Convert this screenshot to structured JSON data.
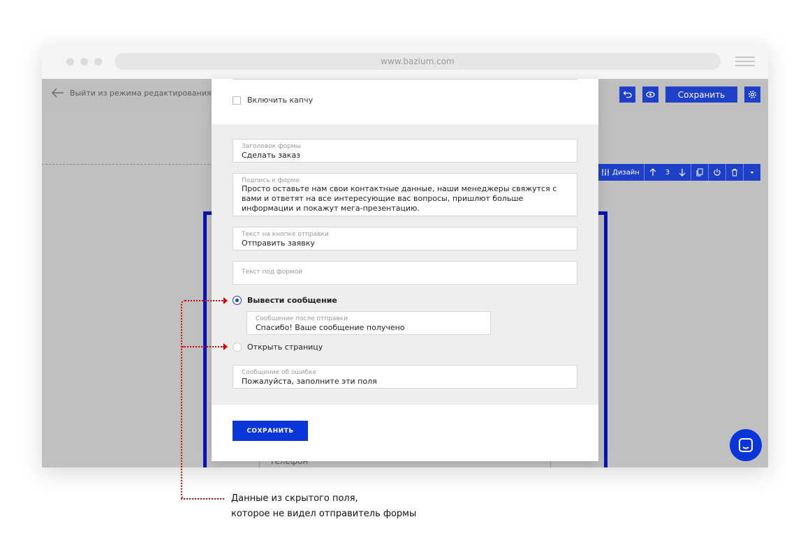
{
  "browser": {
    "url": "www.bazium.com"
  },
  "editor": {
    "exit_label": "Выйти из режима редактирования",
    "save_label": "Сохранить",
    "section_toolbar": {
      "design_label": "Дизайн",
      "position": "3"
    }
  },
  "form_settings": {
    "captcha_label": "Включить капчу",
    "fields": {
      "form_title": {
        "label": "Заголовок формы",
        "value": "Сделать заказ"
      },
      "form_caption": {
        "label": "Подпись к форме",
        "value": "Просто оставьте нам свои контактные данные, наши менеджеры свяжутся с вами и ответят на все интересующие вас вопросы, пришлют больше информации и покажут мега-презентацию."
      },
      "submit_text": {
        "label": "Текст на кнопке отправки",
        "value": "Отправить заявку"
      },
      "below_text": {
        "placeholder": "Текст под формой"
      },
      "after_message": {
        "label": "Сообщение после отправки",
        "value": "Спасибо! Ваше сообщение получено"
      },
      "error_message": {
        "label": "Сообщение об ошибке",
        "value": "Пожалуйста, заполните эти поля"
      }
    },
    "options": {
      "show_message": "Вывести сообщение",
      "open_page": "Открыть страницу",
      "selected": "show_message"
    },
    "save_button": "СОХРАНИТЬ"
  },
  "background_form": {
    "phone_placeholder": "Телефон"
  },
  "annotation": {
    "line1": "Данные из скрытого поля,",
    "line2": "которое не видел отправитель формы"
  },
  "colors": {
    "accent": "#1e40c8",
    "save_button": "#0a35d8",
    "annotation": "#e00000"
  }
}
